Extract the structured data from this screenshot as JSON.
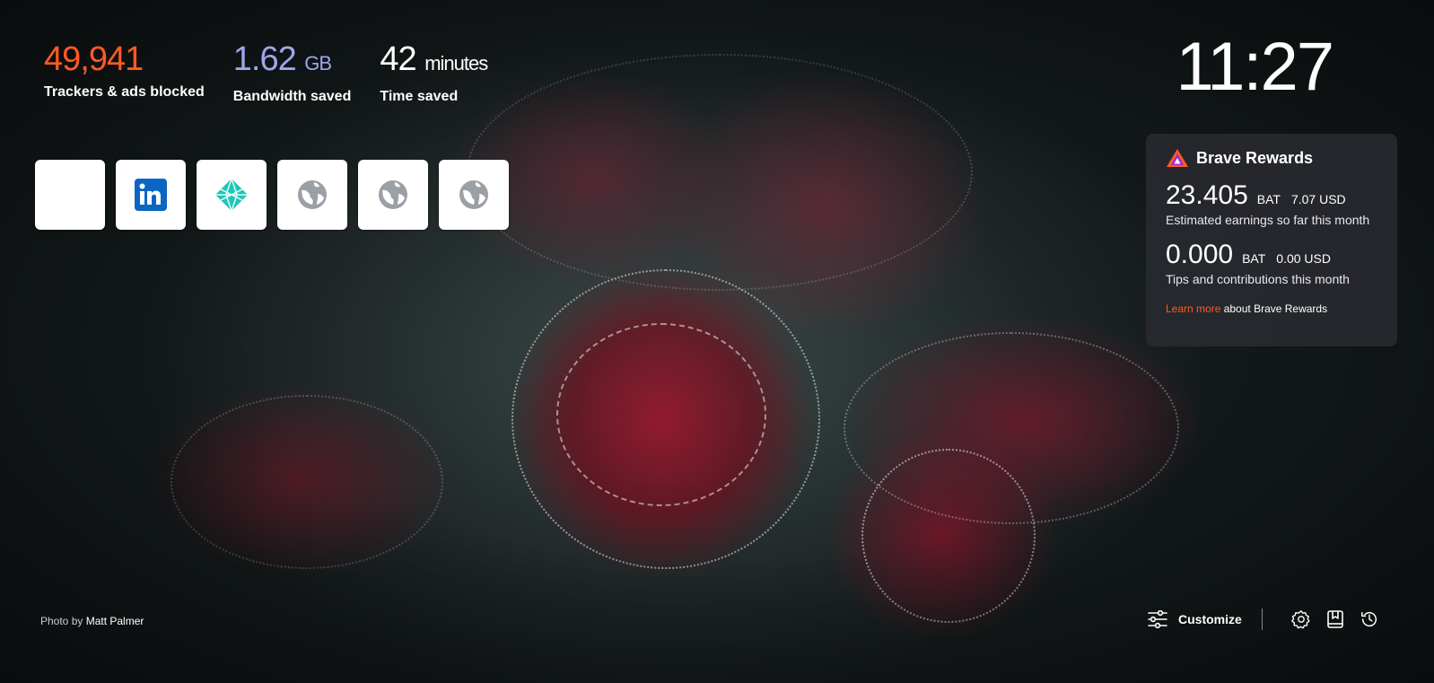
{
  "stats": {
    "trackers": {
      "value": "49,941",
      "label": "Trackers & ads blocked"
    },
    "bandwidth": {
      "value": "1.62",
      "unit": "GB",
      "label": "Bandwidth saved"
    },
    "time": {
      "value": "42",
      "unit": "minutes",
      "label": "Time saved"
    }
  },
  "clock": "11:27",
  "top_sites": [
    {
      "name": "blank",
      "icon": "blank-icon"
    },
    {
      "name": "LinkedIn",
      "icon": "linkedin-icon"
    },
    {
      "name": "Netlify",
      "icon": "netlify-icon"
    },
    {
      "name": "site",
      "icon": "globe-icon"
    },
    {
      "name": "site",
      "icon": "globe-icon"
    },
    {
      "name": "site",
      "icon": "globe-icon"
    }
  ],
  "rewards": {
    "title": "Brave Rewards",
    "earnings": {
      "amount": "23.405",
      "currency": "BAT",
      "usd": "7.07 USD",
      "label": "Estimated earnings so far this month"
    },
    "tips": {
      "amount": "0.000",
      "currency": "BAT",
      "usd": "0.00 USD",
      "label": "Tips and contributions this month"
    },
    "learn_more_link": "Learn more",
    "learn_more_text": " about Brave Rewards"
  },
  "photo_credit": {
    "prefix": "Photo by ",
    "author": "Matt Palmer"
  },
  "footer": {
    "customize_label": "Customize",
    "icons": [
      "settings-icon",
      "bookmarks-icon",
      "history-icon"
    ]
  },
  "colors": {
    "trackers": "#ff5a24",
    "bandwidth": "#a0a5eb",
    "link": "#ff5a24",
    "linkedin": "#0a66c2",
    "netlify": "#20c6b7"
  }
}
